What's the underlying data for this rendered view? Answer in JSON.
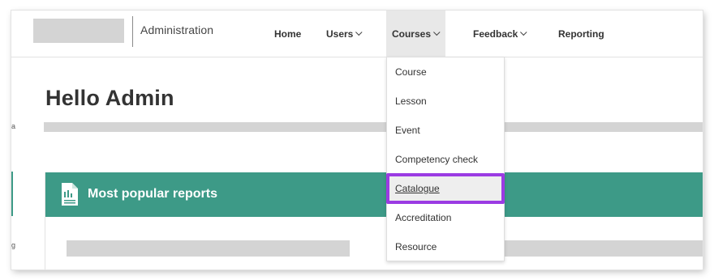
{
  "header": {
    "title": "Administration",
    "nav": {
      "home": "Home",
      "users": "Users",
      "courses": "Courses",
      "feedback": "Feedback",
      "reporting": "Reporting"
    }
  },
  "courses_menu": {
    "items": [
      {
        "label": "Course"
      },
      {
        "label": "Lesson"
      },
      {
        "label": "Event"
      },
      {
        "label": "Competency check"
      },
      {
        "label": "Catalogue",
        "highlighted": true
      },
      {
        "label": "Accreditation"
      },
      {
        "label": "Resource"
      }
    ]
  },
  "main": {
    "greeting": "Hello Admin",
    "panel": {
      "title": "Most popular reports",
      "icon": "report-document-icon",
      "header_color": "#3d9a87"
    }
  },
  "edge_chars": [
    "a",
    "g"
  ],
  "colors": {
    "highlight_outline": "#9b3be3",
    "panel_header": "#3d9a87",
    "placeholder": "#d4d4d4"
  }
}
